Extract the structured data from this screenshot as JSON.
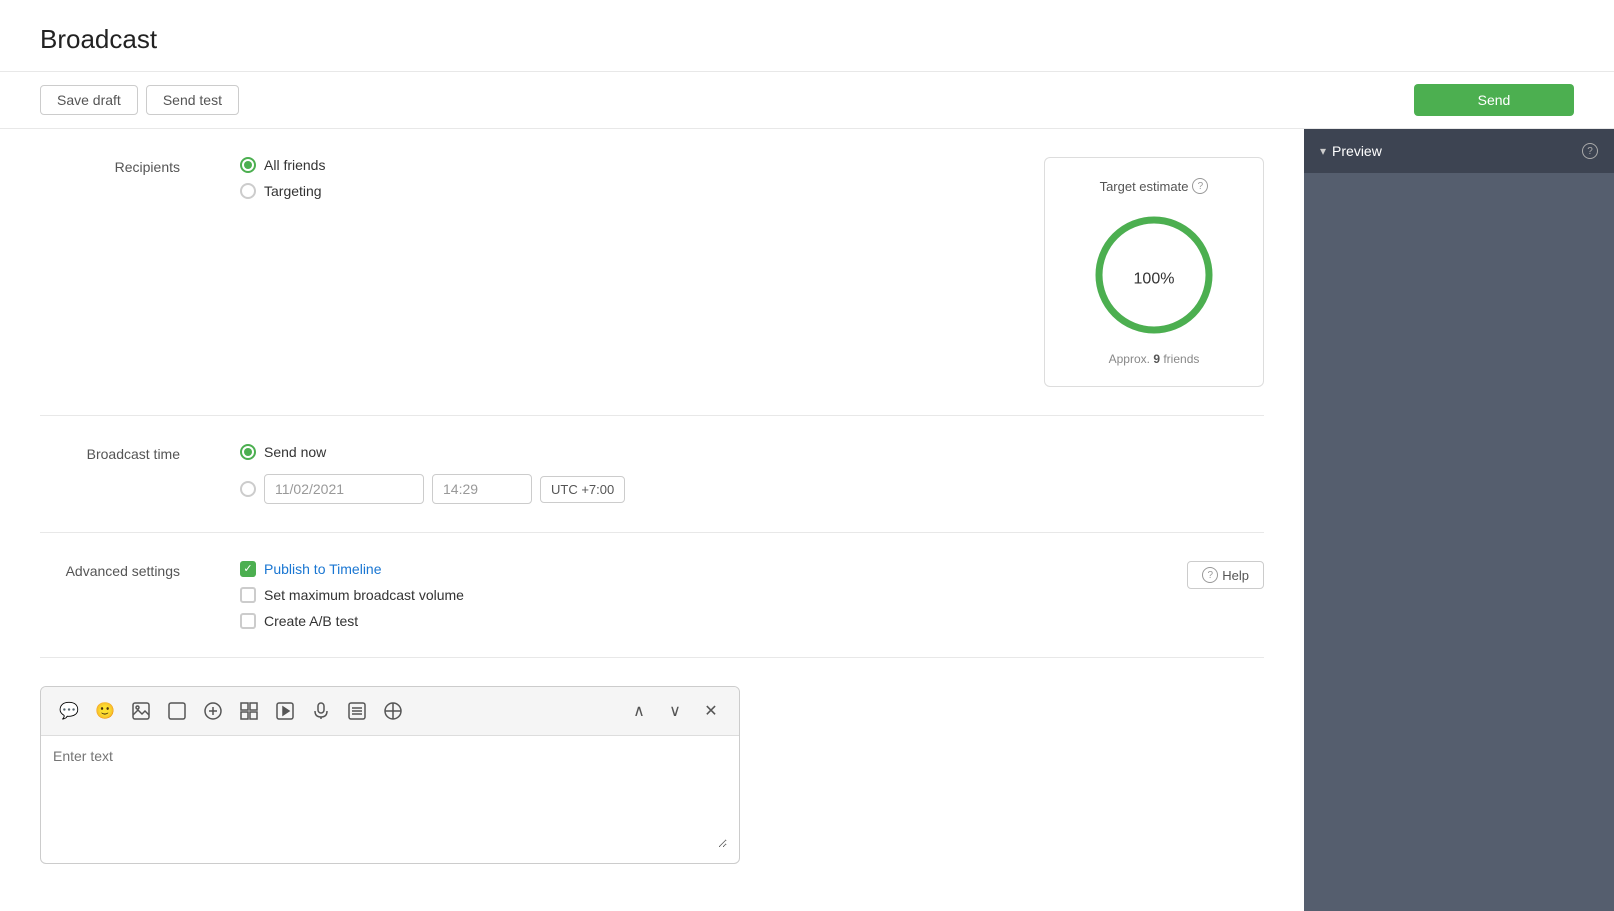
{
  "page": {
    "title": "Broadcast"
  },
  "toolbar": {
    "save_draft_label": "Save draft",
    "send_test_label": "Send test",
    "send_label": "Send"
  },
  "recipients": {
    "label": "Recipients",
    "options": [
      {
        "id": "all_friends",
        "label": "All friends",
        "checked": true
      },
      {
        "id": "targeting",
        "label": "Targeting",
        "checked": false
      }
    ]
  },
  "broadcast_time": {
    "label": "Broadcast time",
    "options": [
      {
        "id": "send_now",
        "label": "Send now",
        "checked": true
      },
      {
        "id": "scheduled",
        "label": "",
        "checked": false
      }
    ],
    "date_value": "11/02/2021",
    "time_value": "14:29",
    "timezone": "UTC +7:00"
  },
  "target_estimate": {
    "title": "Target estimate",
    "percentage": "100",
    "percent_sign": "%",
    "approx_label": "Approx.",
    "approx_count": "9",
    "approx_unit": "friends"
  },
  "advanced_settings": {
    "label": "Advanced settings",
    "options": [
      {
        "id": "publish_timeline",
        "label": "Publish to Timeline",
        "checked": true
      },
      {
        "id": "max_volume",
        "label": "Set maximum broadcast volume",
        "checked": false
      },
      {
        "id": "ab_test",
        "label": "Create A/B test",
        "checked": false
      }
    ],
    "help_label": "Help"
  },
  "editor": {
    "placeholder": "Enter text",
    "icons": [
      {
        "name": "message-icon",
        "glyph": "💬"
      },
      {
        "name": "emoji-icon",
        "glyph": "😊"
      },
      {
        "name": "image-icon",
        "glyph": "🖼"
      },
      {
        "name": "video-icon",
        "glyph": "⬜"
      },
      {
        "name": "add-icon",
        "glyph": "⊕"
      },
      {
        "name": "grid-icon",
        "glyph": "⊞"
      },
      {
        "name": "play-icon",
        "glyph": "▶"
      },
      {
        "name": "mic-icon",
        "glyph": "🎤"
      },
      {
        "name": "list-icon",
        "glyph": "☰"
      },
      {
        "name": "link-icon",
        "glyph": "⊗"
      }
    ],
    "action_up": "∧",
    "action_down": "∨",
    "action_close": "✕"
  },
  "preview": {
    "title": "Preview",
    "chevron": "▾"
  }
}
